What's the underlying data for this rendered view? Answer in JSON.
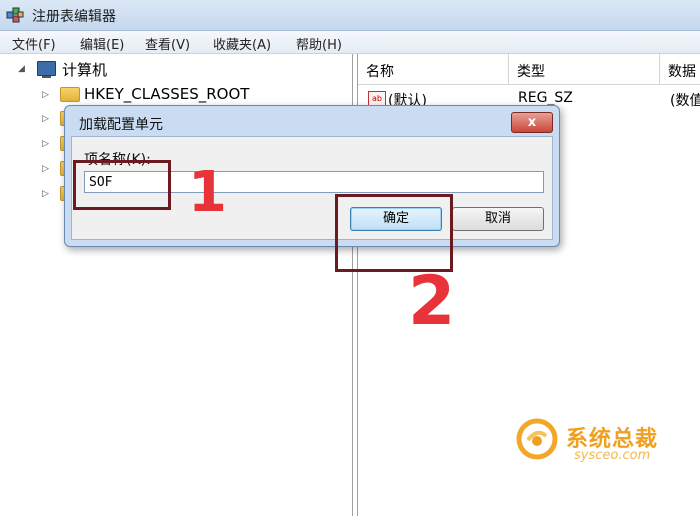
{
  "window": {
    "title": "注册表编辑器"
  },
  "menu": [
    "文件(F)",
    "编辑(E)",
    "查看(V)",
    "收藏夹(A)",
    "帮助(H)"
  ],
  "tree": {
    "root": "计算机",
    "first_key": "HKEY_CLASSES_ROOT"
  },
  "list": {
    "columns": [
      "名称",
      "类型",
      "数据"
    ],
    "row": {
      "name": "(默认)",
      "type": "REG_SZ",
      "data": "(数值"
    }
  },
  "dialog": {
    "title": "加载配置单元",
    "close_label": "x",
    "field_label": "项名称(K):",
    "value": "SOF",
    "ok_label": "确定",
    "cancel_label": "取消"
  },
  "annotations": [
    "1",
    "2"
  ],
  "watermark": {
    "name": "系统总裁",
    "url": "sysceo.com"
  },
  "colors": {
    "annotation_box": "#6b1a22",
    "annotation_number": "#e8333a",
    "watermark": "#f0a020"
  }
}
